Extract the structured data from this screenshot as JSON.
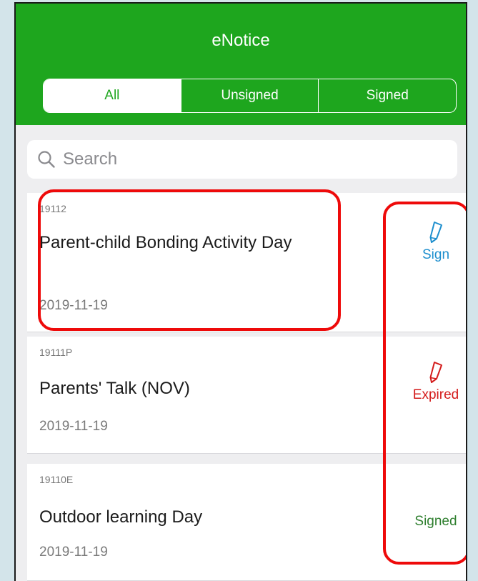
{
  "header": {
    "title": "eNotice",
    "tabs": [
      {
        "label": "All",
        "active": true
      },
      {
        "label": "Unsigned",
        "active": false
      },
      {
        "label": "Signed",
        "active": false
      }
    ]
  },
  "search": {
    "placeholder": "Search",
    "icon": "search-icon"
  },
  "notices": [
    {
      "code": "19112",
      "title": "Parent-child Bonding Activity Day",
      "date": "2019-11-19",
      "status": "Sign",
      "status_color": "#1e8fce",
      "icon": "pencil-icon"
    },
    {
      "code": "19111P",
      "title": "Parents' Talk (NOV)",
      "date": "2019-11-19",
      "status": "Expired",
      "status_color": "#d41c1c",
      "icon": "pencil-icon"
    },
    {
      "code": "19110E",
      "title": "Outdoor learning Day",
      "date": "2019-11-19",
      "status": "Signed",
      "status_color": "#2f7f2f",
      "icon": ""
    }
  ],
  "colors": {
    "header_green": "#1ea61e",
    "highlight_red": "#ee0a0a",
    "page_background": "#eeeef0"
  }
}
